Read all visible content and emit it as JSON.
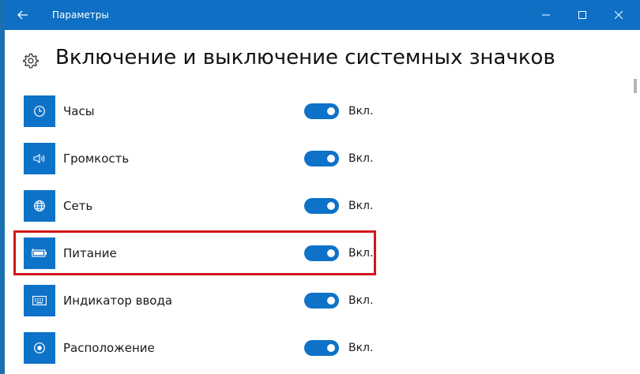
{
  "window": {
    "title": "Параметры",
    "controls": [
      "minimize-icon",
      "maximize-icon",
      "close-icon"
    ]
  },
  "page": {
    "title": "Включение и выключение системных значков",
    "title_icon": "gear-icon"
  },
  "items": [
    {
      "label": "Часы",
      "icon": "clock-icon",
      "state": "Вкл.",
      "on": true
    },
    {
      "label": "Громкость",
      "icon": "speaker-icon",
      "state": "Вкл.",
      "on": true
    },
    {
      "label": "Сеть",
      "icon": "globe-icon",
      "state": "Вкл.",
      "on": true
    },
    {
      "label": "Питание",
      "icon": "battery-icon",
      "state": "Вкл.",
      "on": true
    },
    {
      "label": "Индикатор ввода",
      "icon": "keyboard-icon",
      "state": "Вкл.",
      "on": true
    },
    {
      "label": "Расположение",
      "icon": "location-icon",
      "state": "Вкл.",
      "on": true
    }
  ],
  "colors": {
    "accent": "#0e72c8",
    "titlebar": "#0e6fc4",
    "highlight": "#d4161c"
  }
}
